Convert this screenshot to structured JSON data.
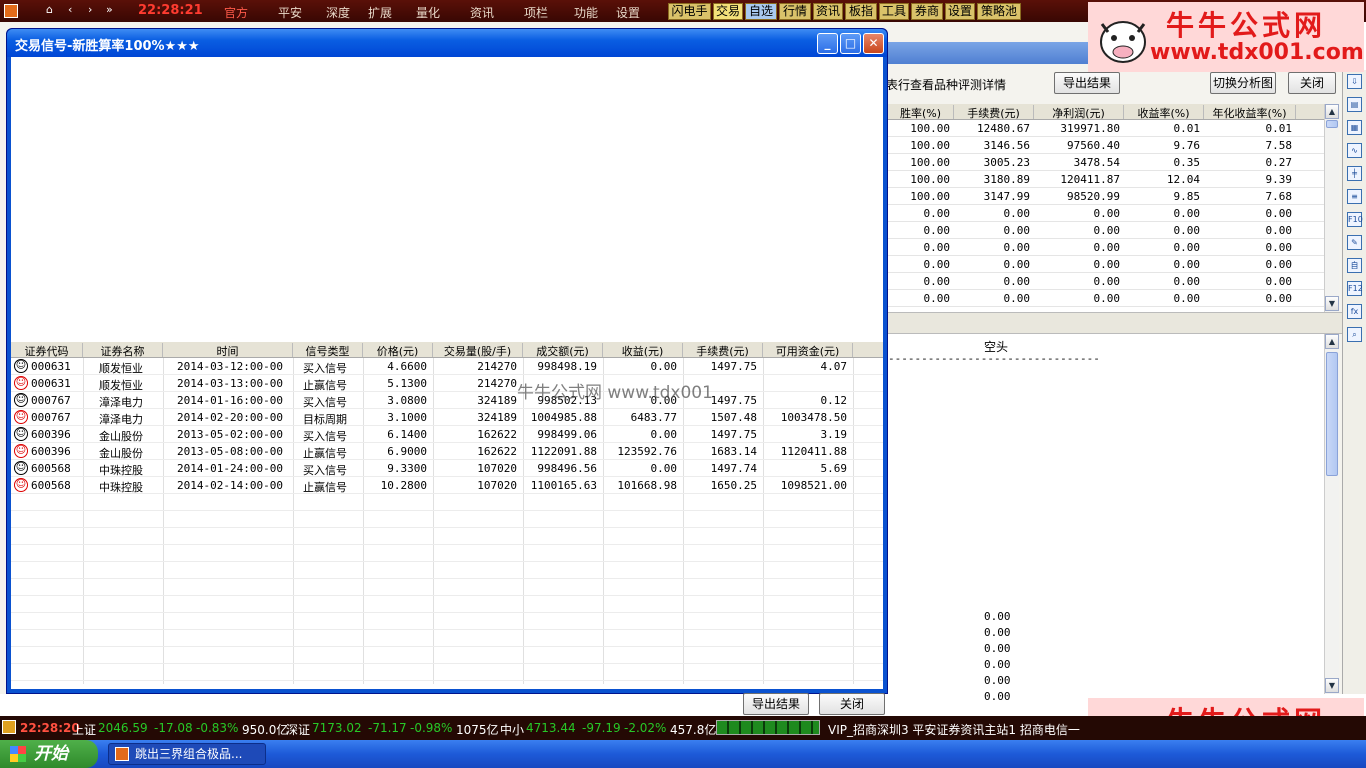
{
  "topbar": {
    "clock": "22:28:21",
    "menu": [
      "官方",
      "平安",
      "深度",
      "扩展",
      "量化",
      "资讯",
      "项栏",
      "功能",
      "设置"
    ],
    "tools": [
      "闪电手",
      "交易",
      "自选",
      "行情",
      "资讯",
      "板指",
      "工具",
      "券商",
      "设置",
      "策略池"
    ]
  },
  "watermark": {
    "name": "牛牛公式网",
    "url": "www.tdx001.com"
  },
  "bgwindow": {
    "hint": "表行查看品种评测详情",
    "export_btn": "导出结果",
    "switch_btn": "切换分析图",
    "close_btn": "关闭",
    "headers": [
      "胜率(%)",
      "手续费(元)",
      "净利润(元)",
      "收益率(%)",
      "年化收益率(%)"
    ],
    "rows": [
      [
        "100.00",
        "12480.67",
        "319971.80",
        "0.01",
        "0.01"
      ],
      [
        "100.00",
        "3146.56",
        "97560.40",
        "9.76",
        "7.58"
      ],
      [
        "100.00",
        "3005.23",
        "3478.54",
        "0.35",
        "0.27"
      ],
      [
        "100.00",
        "3180.89",
        "120411.87",
        "12.04",
        "9.39"
      ],
      [
        "100.00",
        "3147.99",
        "98520.99",
        "9.85",
        "7.68"
      ],
      [
        "0.00",
        "0.00",
        "0.00",
        "0.00",
        "0.00"
      ],
      [
        "0.00",
        "0.00",
        "0.00",
        "0.00",
        "0.00"
      ],
      [
        "0.00",
        "0.00",
        "0.00",
        "0.00",
        "0.00"
      ],
      [
        "0.00",
        "0.00",
        "0.00",
        "0.00",
        "0.00"
      ],
      [
        "0.00",
        "0.00",
        "0.00",
        "0.00",
        "0.00"
      ],
      [
        "0.00",
        "0.00",
        "0.00",
        "0.00",
        "0.00"
      ]
    ],
    "short_label": "空头",
    "dashes": "--------------------------------",
    "zeros": [
      "0.00",
      "0.00",
      "0.00",
      "0.00",
      "0.00",
      "0.00"
    ]
  },
  "dialog": {
    "title": "交易信号-新胜算率100%★★★",
    "headers": [
      "证券代码",
      "证券名称",
      "时间",
      "信号类型",
      "价格(元)",
      "交易量(股/手)",
      "成交额(元)",
      "收益(元)",
      "手续费(元)",
      "可用资金(元)"
    ],
    "rows": [
      {
        "face": "black",
        "code": "000631",
        "name": "顺发恒业",
        "time": "2014-03-12:00-00",
        "type": "买入信号",
        "price": "4.6600",
        "volume": "214270",
        "amount": "998498.19",
        "profit": "0.00",
        "fee": "1497.75",
        "cash": "4.07"
      },
      {
        "face": "red",
        "code": "000631",
        "name": "顺发恒业",
        "time": "2014-03-13:00-00",
        "type": "止赢信号",
        "price": "5.1300",
        "volume": "214270",
        "amount": "",
        "profit": "",
        "fee": "",
        "cash": ""
      },
      {
        "face": "black",
        "code": "000767",
        "name": "漳泽电力",
        "time": "2014-01-16:00-00",
        "type": "买入信号",
        "price": "3.0800",
        "volume": "324189",
        "amount": "998502.13",
        "profit": "0.00",
        "fee": "1497.75",
        "cash": "0.12"
      },
      {
        "face": "red",
        "code": "000767",
        "name": "漳泽电力",
        "time": "2014-02-20:00-00",
        "type": "目标周期",
        "price": "3.1000",
        "volume": "324189",
        "amount": "1004985.88",
        "profit": "6483.77",
        "fee": "1507.48",
        "cash": "1003478.50"
      },
      {
        "face": "black",
        "code": "600396",
        "name": "金山股份",
        "time": "2013-05-02:00-00",
        "type": "买入信号",
        "price": "6.1400",
        "volume": "162622",
        "amount": "998499.06",
        "profit": "0.00",
        "fee": "1497.75",
        "cash": "3.19"
      },
      {
        "face": "red",
        "code": "600396",
        "name": "金山股份",
        "time": "2013-05-08:00-00",
        "type": "止赢信号",
        "price": "6.9000",
        "volume": "162622",
        "amount": "1122091.88",
        "profit": "123592.76",
        "fee": "1683.14",
        "cash": "1120411.88"
      },
      {
        "face": "black",
        "code": "600568",
        "name": "中珠控股",
        "time": "2014-01-24:00-00",
        "type": "买入信号",
        "price": "9.3300",
        "volume": "107020",
        "amount": "998496.56",
        "profit": "0.00",
        "fee": "1497.74",
        "cash": "5.69"
      },
      {
        "face": "red",
        "code": "600568",
        "name": "中珠控股",
        "time": "2014-02-14:00-00",
        "type": "止赢信号",
        "price": "10.2800",
        "volume": "107020",
        "amount": "1100165.63",
        "profit": "101668.98",
        "fee": "1650.25",
        "cash": "1098521.00"
      }
    ],
    "overlay_text": "牛牛公式网 www.tdx001",
    "export_btn": "导出结果",
    "close_btn": "关闭"
  },
  "statusbar": {
    "time": "22:28:20",
    "sh_label": "上证",
    "sh_val": "2046.59",
    "sh_chg": "-17.08",
    "sh_pct": "-0.83%",
    "sh_vol": "950.0亿",
    "sz_label": "深证",
    "sz_val": "7173.02",
    "sz_chg": "-71.17",
    "sz_pct": "-0.98%",
    "sz_vol": "1075亿",
    "zx_label": "中小",
    "zx_val": "4713.44",
    "zx_chg": "-97.19",
    "zx_pct": "-2.02%",
    "zx_vol": "457.8亿",
    "servers": "VIP_招商深圳3  平安证券资讯主站1  招商电信一"
  },
  "taskbar": {
    "start": "开始",
    "task": "跳出三界组合极品..."
  }
}
